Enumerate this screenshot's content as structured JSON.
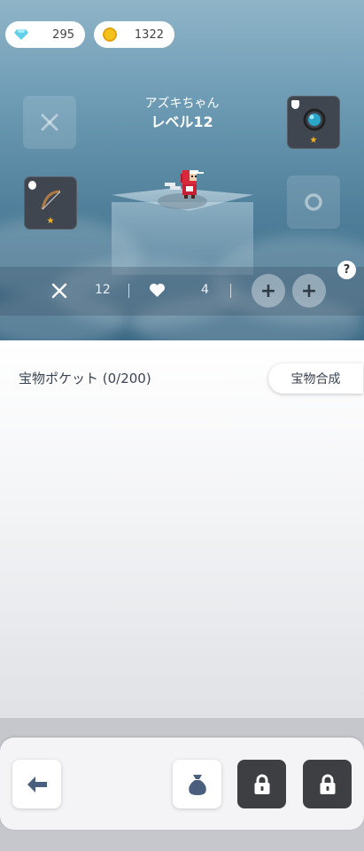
{
  "currency": {
    "gems": "295",
    "coins": "1322",
    "gem_icon": "diamond-icon",
    "coin_icon": "coin-icon"
  },
  "character": {
    "name": "アズキちゃん",
    "level": "レベル12"
  },
  "equipment": {
    "weapon_slot_icon": "crossed-swords-icon",
    "ring_slot_icon": "ring-icon",
    "star_rating": "★"
  },
  "stats": {
    "attack": "12",
    "health": "4",
    "attack_icon": "crossed-swords-icon",
    "health_icon": "heart-icon",
    "plus": "+",
    "help": "?"
  },
  "pocket": {
    "title": "宝物ポケット (0/200)",
    "synth_button": "宝物合成"
  },
  "bottom_nav": {
    "back_icon": "back-arrow-icon",
    "bag_icon": "treasure-bag-icon",
    "lock_icon": "lock-icon"
  },
  "colors": {
    "star": "#f5b51e",
    "coin": "#f3c21b",
    "gem": "#5fd0e8",
    "locked_button": "#3e3f42",
    "nav_icon": "#4a5e7e"
  }
}
